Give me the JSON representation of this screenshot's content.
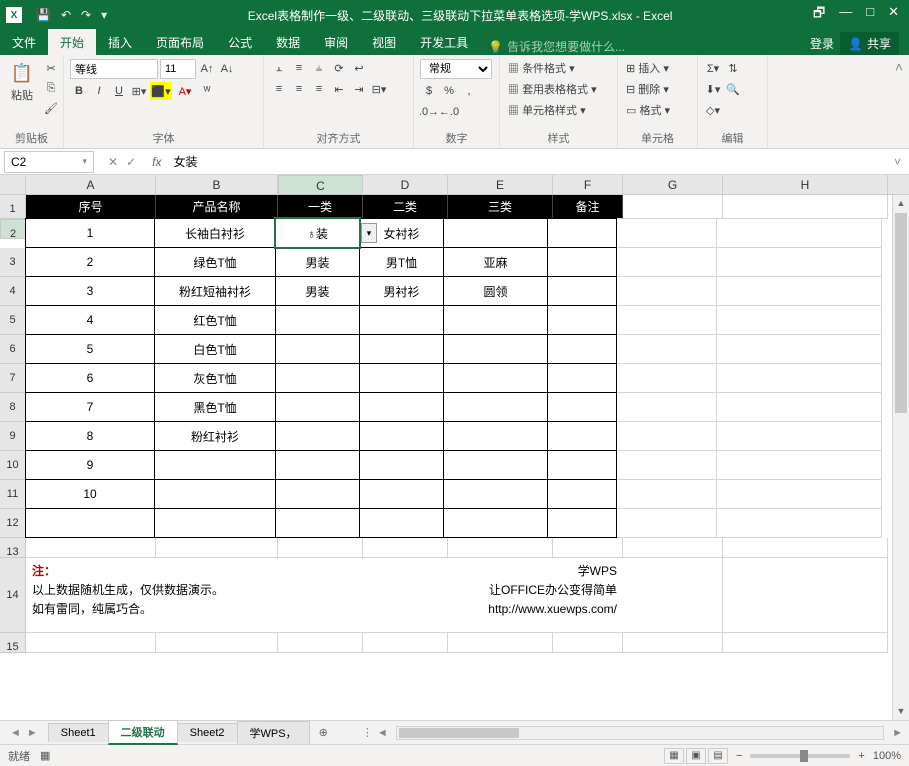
{
  "titlebar": {
    "title": "Excel表格制作一级、二级联动、三级联动下拉菜单表格选项-学WPS.xlsx - Excel",
    "qat_save": "💾",
    "qat_undo": "↶",
    "qat_redo": "↷",
    "win_restore": "🗗",
    "win_min": "—",
    "win_max": "□",
    "win_close": "✕"
  },
  "tabs": {
    "file": "文件",
    "home": "开始",
    "insert": "插入",
    "layout": "页面布局",
    "formulas": "公式",
    "data": "数据",
    "review": "审阅",
    "view": "视图",
    "dev": "开发工具",
    "tell": "告诉我您想要做什么...",
    "login": "登录",
    "share": "共享"
  },
  "ribbon": {
    "clipboard": {
      "paste": "粘贴",
      "label": "剪贴板"
    },
    "font": {
      "name": "等线",
      "size": "11",
      "bold": "B",
      "italic": "I",
      "underline": "U",
      "label": "字体"
    },
    "align": {
      "label": "对齐方式"
    },
    "number": {
      "format": "常规",
      "label": "数字"
    },
    "styles": {
      "cond": "条件格式",
      "table": "套用表格格式",
      "cell": "单元格样式",
      "label": "样式"
    },
    "cells": {
      "insert": "插入",
      "delete": "删除",
      "format": "格式",
      "label": "单元格"
    },
    "editing": {
      "label": "编辑"
    }
  },
  "formula": {
    "namebox": "C2",
    "value": "女装"
  },
  "cols": [
    "A",
    "B",
    "C",
    "D",
    "E",
    "F",
    "G",
    "H"
  ],
  "headers": {
    "A": "序号",
    "B": "产品名称",
    "C": "一类",
    "D": "二类",
    "E": "三类",
    "F": "备注"
  },
  "rows": [
    {
      "n": "1",
      "a": "1",
      "b": "长袖白衬衫",
      "c": "女装",
      "d": "女衬衫",
      "e": "",
      "f": ""
    },
    {
      "n": "2",
      "a": "2",
      "b": "绿色T恤",
      "c": "男装",
      "d": "男T恤",
      "e": "亚麻",
      "f": ""
    },
    {
      "n": "3",
      "a": "3",
      "b": "粉红短袖衬衫",
      "c": "男装",
      "d": "男衬衫",
      "e": "圆领",
      "f": ""
    },
    {
      "n": "4",
      "a": "4",
      "b": "红色T恤",
      "c": "",
      "d": "",
      "e": "",
      "f": ""
    },
    {
      "n": "5",
      "a": "5",
      "b": "白色T恤",
      "c": "",
      "d": "",
      "e": "",
      "f": ""
    },
    {
      "n": "6",
      "a": "6",
      "b": "灰色T恤",
      "c": "",
      "d": "",
      "e": "",
      "f": ""
    },
    {
      "n": "7",
      "a": "7",
      "b": "黑色T恤",
      "c": "",
      "d": "",
      "e": "",
      "f": ""
    },
    {
      "n": "8",
      "a": "8",
      "b": "粉红衬衫",
      "c": "",
      "d": "",
      "e": "",
      "f": ""
    },
    {
      "n": "9",
      "a": "9",
      "b": "",
      "c": "",
      "d": "",
      "e": "",
      "f": ""
    },
    {
      "n": "10",
      "a": "10",
      "b": "",
      "c": "",
      "d": "",
      "e": "",
      "f": ""
    },
    {
      "n": "11",
      "a": "",
      "b": "",
      "c": "",
      "d": "",
      "e": "",
      "f": ""
    }
  ],
  "active_cell_display": "♁装",
  "note": {
    "title": "注：",
    "l1": "以上数据随机生成，仅供数据演示。",
    "l2": "如有雷同，纯属巧合。",
    "r1": "学WPS",
    "r2": "让OFFICE办公变得简单",
    "r3": "http://www.xuewps.com/"
  },
  "sheets": {
    "s1": "Sheet1",
    "s2": "二级联动",
    "s3": "Sheet2",
    "s4": "学WPS，"
  },
  "status": {
    "ready": "就绪",
    "zoom": "100%"
  }
}
